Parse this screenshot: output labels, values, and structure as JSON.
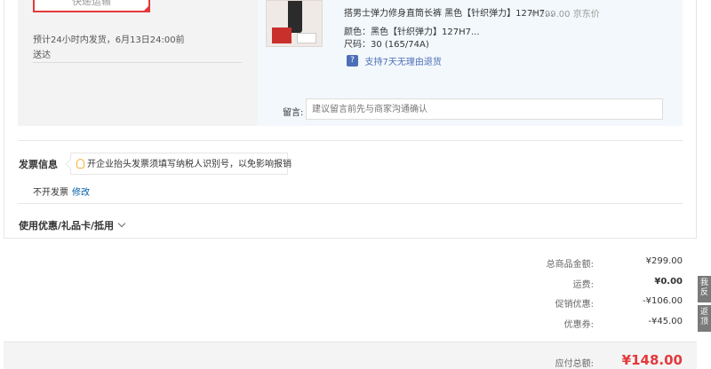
{
  "shipping": {
    "method_button": "快递运输",
    "time_text": "预计24小时内发货，6月13日24:00前",
    "time_text_2": "送达"
  },
  "product": {
    "title": "搭男士弹力修身直筒长裤 黑色【针织弹力】127H7...",
    "jd_price": "¥ 299.00 京东价",
    "color_label": "颜色：",
    "color_value": "黑色【针织弹力】127H7...",
    "size_label": "尺码：",
    "size_value": "30 (165/74A)",
    "return_icon": "?",
    "return_policy": "支持7天无理由退货"
  },
  "note": {
    "label": "留言:",
    "placeholder": "建议留言前先与商家沟通确认"
  },
  "invoice": {
    "title": "发票信息",
    "tip": "开企业抬头发票须填写纳税人识别号，以免影响报销",
    "value": "不开发票",
    "edit_link": "修改"
  },
  "coupon": {
    "label": "使用优惠/礼品卡/抵用"
  },
  "summary": {
    "rows": [
      {
        "label": "总商品金额:",
        "value": "¥299.00"
      },
      {
        "label": "运费:",
        "value": "¥0.00"
      },
      {
        "label": "促销优惠:",
        "value": "-¥106.00"
      },
      {
        "label": "优惠券:",
        "value": "-¥45.00"
      }
    ],
    "total_label": "应付总额:",
    "total_value": "¥148.00"
  },
  "side_tabs": [
    {
      "label": "我反"
    },
    {
      "label": "返顶"
    }
  ],
  "colors": {
    "accent_red": "#e4393c",
    "link_blue": "#005ea7",
    "panel_bg": "#f3f3f3",
    "product_bg": "#f3f8fc"
  },
  "icons": {
    "bulb": "lightbulb-icon",
    "return": "return-policy-icon",
    "chevron": "chevron-down-icon"
  }
}
